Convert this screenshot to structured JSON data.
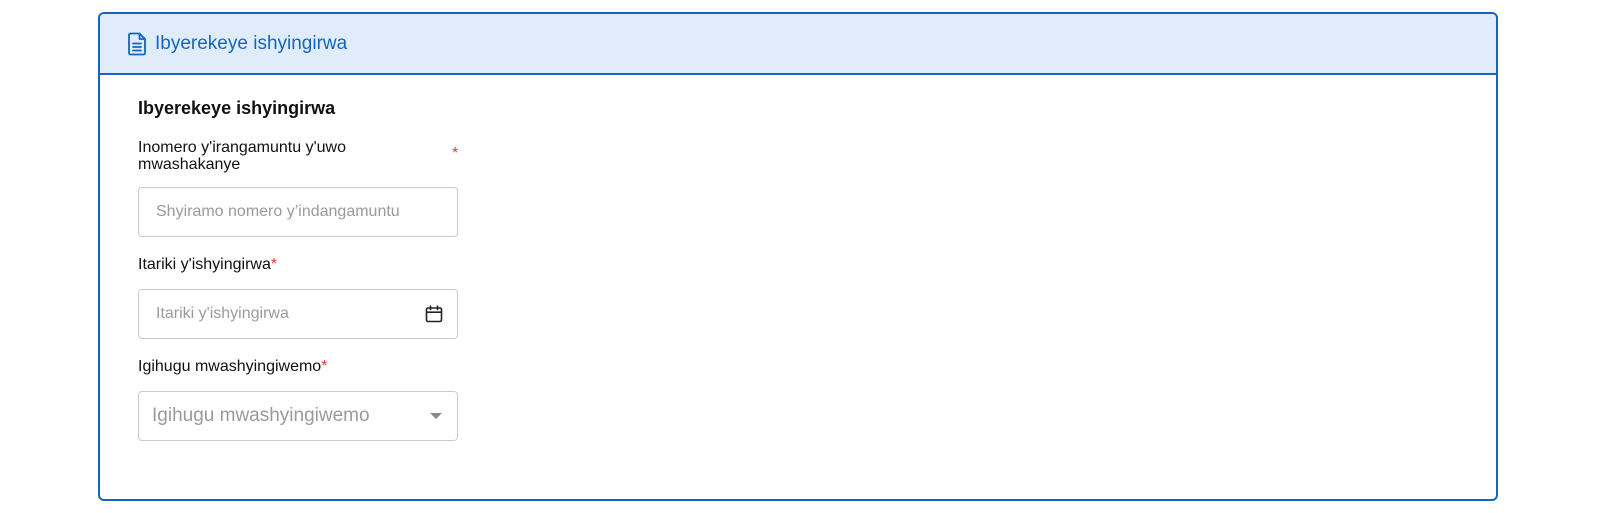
{
  "panel": {
    "header_title": "Ibyerekeye ishyingirwa",
    "icon": "document-icon",
    "accent_color": "#1565c0",
    "header_bg": "#e1ecfa"
  },
  "form": {
    "section_title": "Ibyerekeye ishyingirwa",
    "required_mark": "*",
    "spouse_id": {
      "label": "Inomero y'irangamuntu y'uwo mwashakanye",
      "placeholder": "Shyiramo nomero y’indangamuntu",
      "value": ""
    },
    "marriage_date": {
      "label": "Itariki y'ishyingirwa",
      "placeholder": "Itariki y'ishyingirwa",
      "value": "",
      "icon": "calendar-icon"
    },
    "marriage_country": {
      "label": "Igihugu mwashyingiwemo",
      "placeholder": "Igihugu mwashyingiwemo",
      "icon": "caret-down-icon"
    }
  }
}
